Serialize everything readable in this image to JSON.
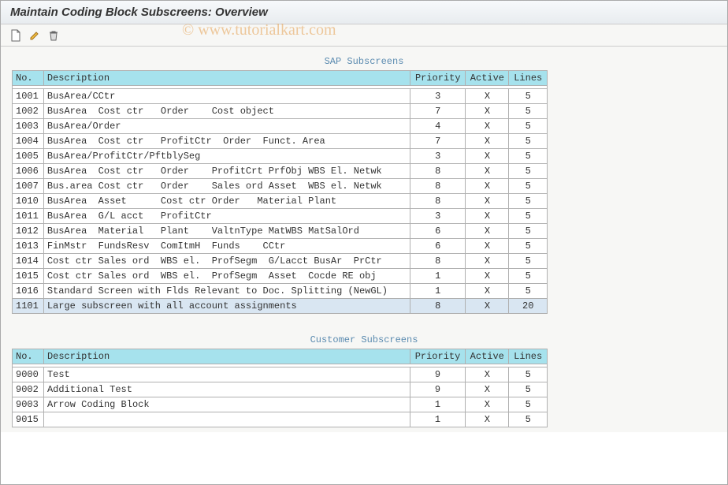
{
  "title": "Maintain Coding Block Subscreens: Overview",
  "watermark": "© www.tutorialkart.com",
  "toolbar": {
    "new_icon": "new-doc-icon",
    "edit_icon": "edit-icon",
    "delete_icon": "delete-icon"
  },
  "sections": {
    "sap": {
      "title": "SAP Subscreens",
      "columns": {
        "no": "No.",
        "desc": "Description",
        "prio": "Priority",
        "active": "Active",
        "lines": "Lines"
      },
      "rows": [
        {
          "no": "1001",
          "desc": "BusArea/CCtr",
          "prio": "3",
          "active": "X",
          "lines": "5"
        },
        {
          "no": "1002",
          "desc": "BusArea  Cost ctr   Order    Cost object",
          "prio": "7",
          "active": "X",
          "lines": "5"
        },
        {
          "no": "1003",
          "desc": "BusArea/Order",
          "prio": "4",
          "active": "X",
          "lines": "5"
        },
        {
          "no": "1004",
          "desc": "BusArea  Cost ctr   ProfitCtr  Order  Funct. Area",
          "prio": "7",
          "active": "X",
          "lines": "5"
        },
        {
          "no": "1005",
          "desc": "BusArea/ProfitCtr/PftblySeg",
          "prio": "3",
          "active": "X",
          "lines": "5"
        },
        {
          "no": "1006",
          "desc": "BusArea  Cost ctr   Order    ProfitCrt PrfObj WBS El. Netwk",
          "prio": "8",
          "active": "X",
          "lines": "5"
        },
        {
          "no": "1007",
          "desc": "Bus.area Cost ctr   Order    Sales ord Asset  WBS el. Netwk",
          "prio": "8",
          "active": "X",
          "lines": "5"
        },
        {
          "no": "1010",
          "desc": "BusArea  Asset      Cost ctr Order   Material Plant",
          "prio": "8",
          "active": "X",
          "lines": "5"
        },
        {
          "no": "1011",
          "desc": "BusArea  G/L acct   ProfitCtr",
          "prio": "3",
          "active": "X",
          "lines": "5"
        },
        {
          "no": "1012",
          "desc": "BusArea  Material   Plant    ValtnType MatWBS MatSalOrd",
          "prio": "6",
          "active": "X",
          "lines": "5"
        },
        {
          "no": "1013",
          "desc": "FinMstr  FundsResv  ComItmH  Funds    CCtr",
          "prio": "6",
          "active": "X",
          "lines": "5"
        },
        {
          "no": "1014",
          "desc": "Cost ctr Sales ord  WBS el.  ProfSegm  G/Lacct BusAr  PrCtr",
          "prio": "8",
          "active": "X",
          "lines": "5"
        },
        {
          "no": "1015",
          "desc": "Cost ctr Sales ord  WBS el.  ProfSegm  Asset  Cocde RE obj",
          "prio": "1",
          "active": "X",
          "lines": "5"
        },
        {
          "no": "1016",
          "desc": "Standard Screen with Flds Relevant to Doc. Splitting (NewGL)",
          "prio": "1",
          "active": "X",
          "lines": "5"
        },
        {
          "no": "1101",
          "desc": "Large subscreen with all account assignments",
          "prio": "8",
          "active": "X",
          "lines": "20",
          "selected": true
        }
      ]
    },
    "customer": {
      "title": "Customer Subscreens",
      "columns": {
        "no": "No.",
        "desc": "Description",
        "prio": "Priority",
        "active": "Active",
        "lines": "Lines"
      },
      "rows": [
        {
          "no": "9000",
          "desc": "Test",
          "prio": "9",
          "active": "X",
          "lines": "5"
        },
        {
          "no": "9002",
          "desc": "Additional Test",
          "prio": "9",
          "active": "X",
          "lines": "5"
        },
        {
          "no": "9003",
          "desc": "Arrow Coding Block",
          "prio": "1",
          "active": "X",
          "lines": "5"
        },
        {
          "no": "9015",
          "desc": "",
          "prio": "1",
          "active": "X",
          "lines": "5"
        }
      ]
    }
  }
}
